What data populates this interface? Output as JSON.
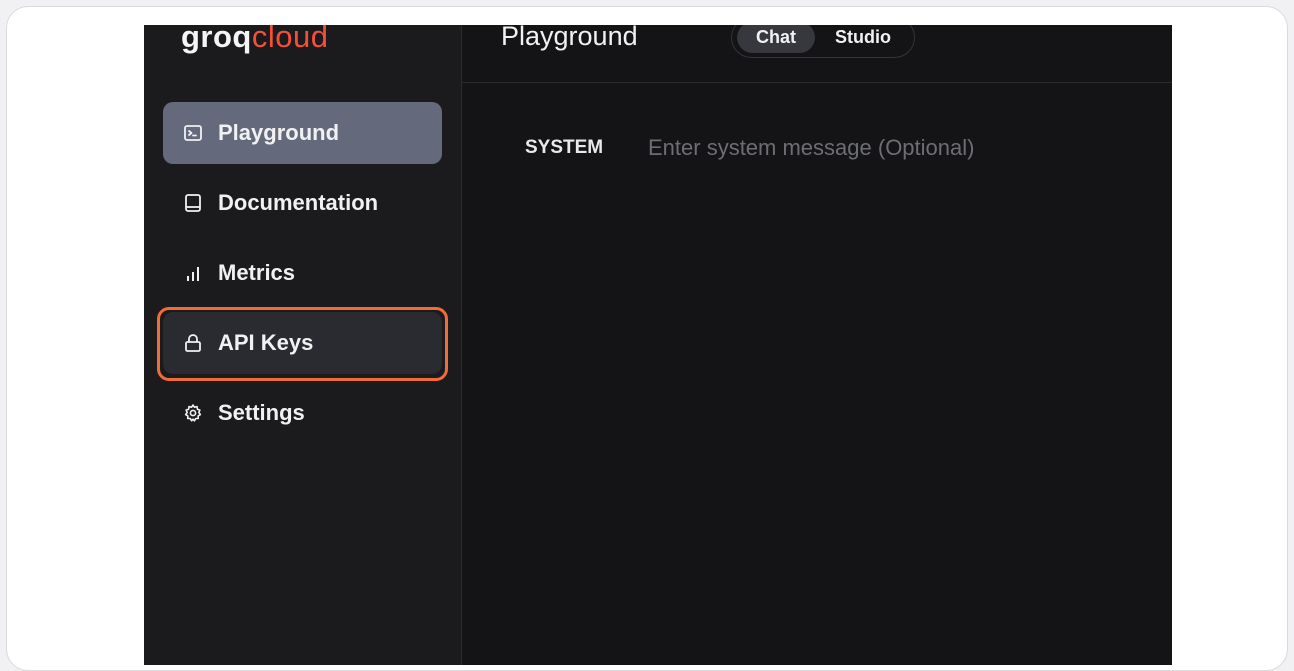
{
  "brand": {
    "logo_part1": "groq",
    "logo_part2": "cloud",
    "accent_color": "#f55036"
  },
  "sidebar": {
    "items": [
      {
        "label": "Playground",
        "icon": "terminal-icon",
        "state": "active"
      },
      {
        "label": "Documentation",
        "icon": "book-icon",
        "state": "normal"
      },
      {
        "label": "Metrics",
        "icon": "bar-chart-icon",
        "state": "normal"
      },
      {
        "label": "API Keys",
        "icon": "lock-icon",
        "state": "highlighted"
      },
      {
        "label": "Settings",
        "icon": "gear-icon",
        "state": "normal"
      }
    ],
    "highlight_color": "#f26b3a"
  },
  "header": {
    "title": "Playground",
    "modes": [
      {
        "label": "Chat",
        "selected": true
      },
      {
        "label": "Studio",
        "selected": false
      }
    ]
  },
  "main": {
    "system_label": "SYSTEM",
    "system_placeholder": "Enter system message (Optional)",
    "system_value": ""
  }
}
